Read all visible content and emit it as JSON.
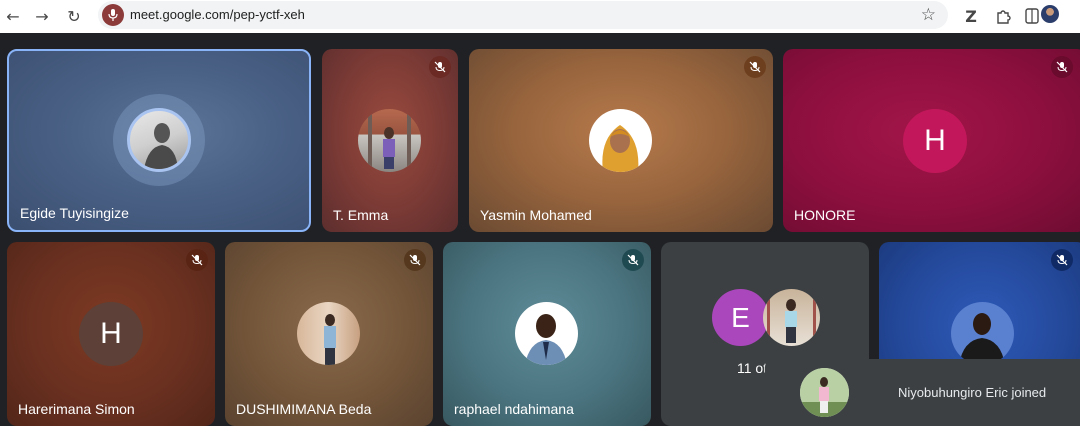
{
  "browser": {
    "url": "meet.google.com/pep-yctf-xeh",
    "back_icon": "back-arrow-icon",
    "forward_icon": "forward-arrow-icon",
    "reload_icon": "reload-icon",
    "bookmark_icon": "star-icon",
    "extensions_icon": "puzzle-icon"
  },
  "participants": [
    {
      "name": "Egide Tuyisingize",
      "avatar_type": "photo",
      "speaking": true,
      "muted": false
    },
    {
      "name": "T. Emma",
      "avatar_type": "photo",
      "muted": true
    },
    {
      "name": "Yasmin Mohamed",
      "avatar_type": "photo",
      "muted": true
    },
    {
      "name": "HONORE",
      "avatar_type": "initial",
      "initial": "H",
      "avatar_color": "#c2185b",
      "muted": true
    },
    {
      "name": "Harerimana Simon",
      "avatar_type": "initial",
      "initial": "H",
      "avatar_color": "#5d4037",
      "muted": true
    },
    {
      "name": "DUSHIMIMANA Beda",
      "avatar_type": "photo",
      "muted": true
    },
    {
      "name": "raphael ndahimana",
      "avatar_type": "photo",
      "muted": true
    },
    {
      "name": "",
      "avatar_type": "photo",
      "muted": true
    }
  ],
  "others_tile": {
    "initial": "E",
    "initial_color": "#ab47bc",
    "label": "11 ot"
  },
  "toast": {
    "message": "Niyobuhungiro Eric joined"
  },
  "colors": {
    "speaking_border": "#8ab4f8",
    "meet_bg": "#202124"
  }
}
